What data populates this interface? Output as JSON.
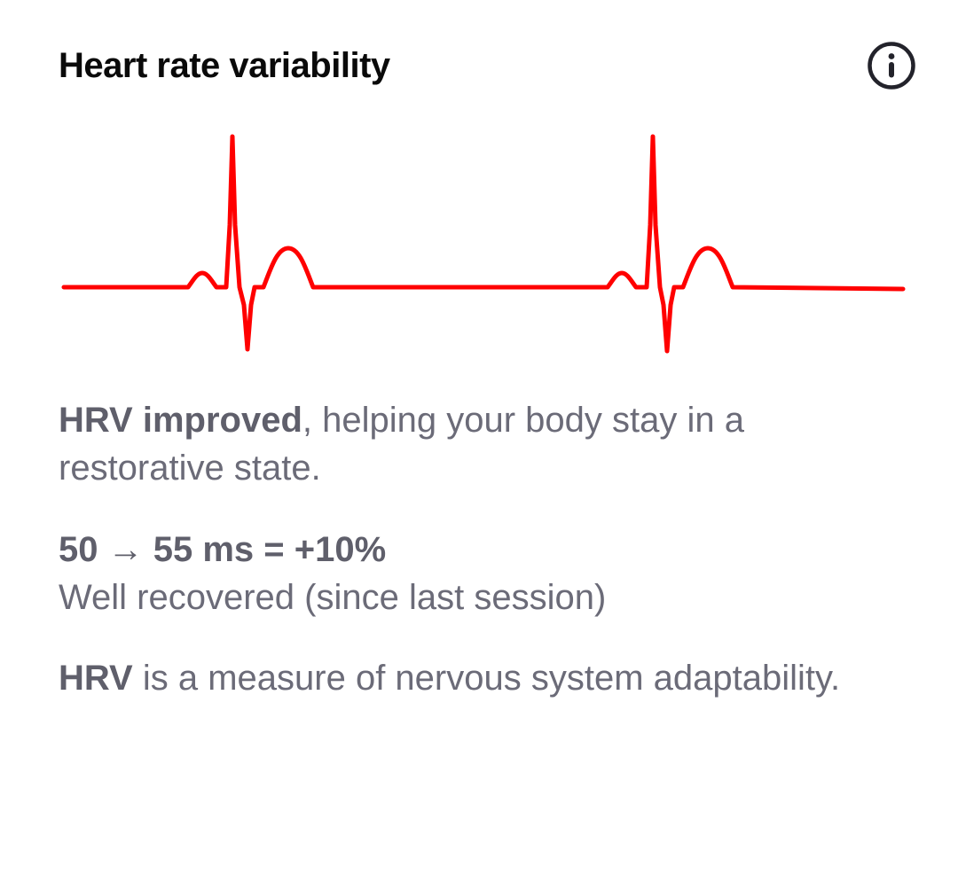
{
  "card": {
    "title": "Heart rate variability",
    "info_icon": "info-circle-icon",
    "waveform_color": "#ff0000",
    "summary": {
      "bold": "HRV improved",
      "rest": ", helping your body stay in a restorative state."
    },
    "change": {
      "line": "50 → 55 ms = +10%",
      "status": "Well recovered (since last session)"
    },
    "definition": {
      "bold": "HRV",
      "rest": " is a measure of nervous system adaptability."
    }
  }
}
